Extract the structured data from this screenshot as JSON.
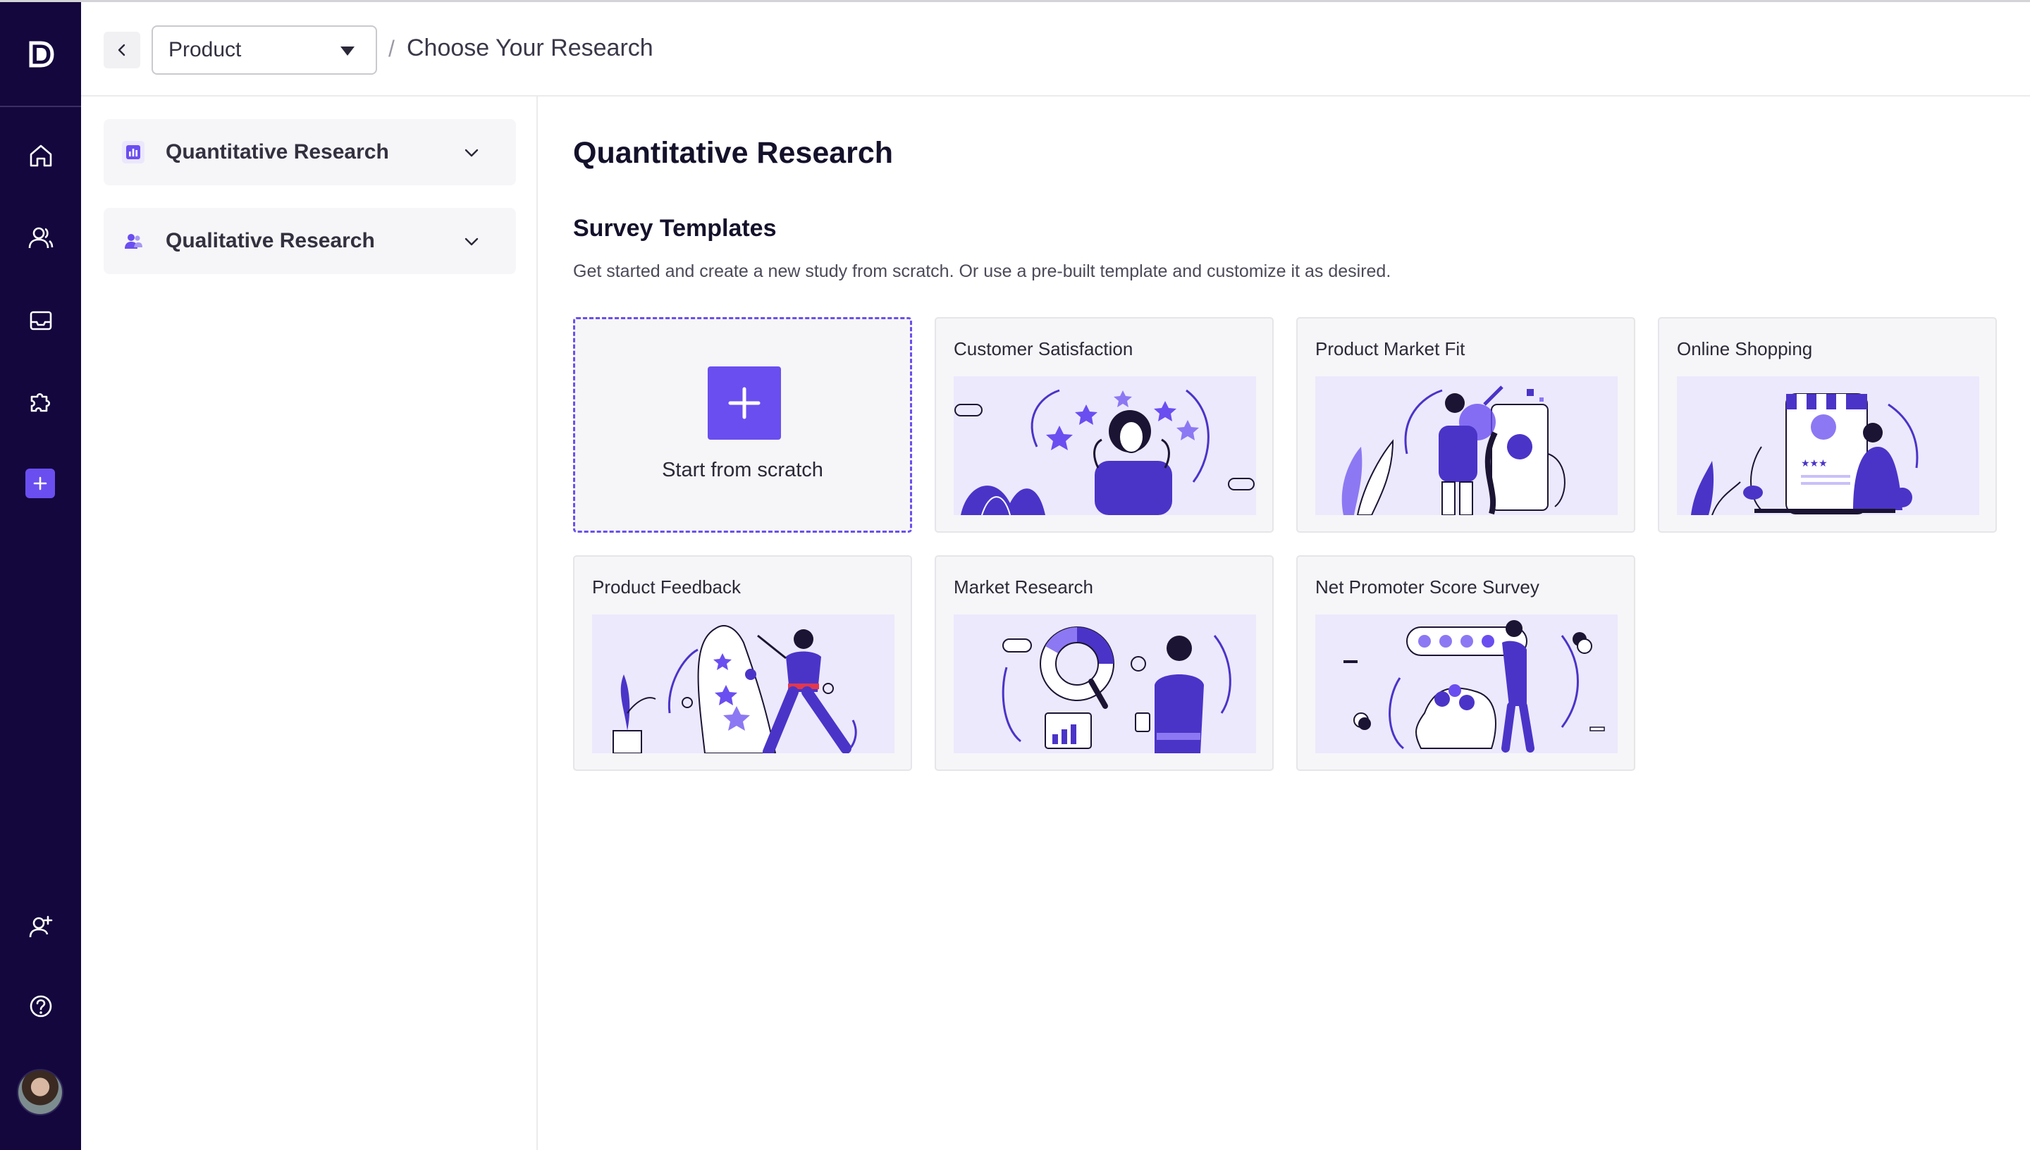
{
  "app": {
    "logo_letter": "D"
  },
  "rail": {
    "items": [
      {
        "name": "home",
        "icon": "home-icon"
      },
      {
        "name": "people",
        "icon": "users-icon"
      },
      {
        "name": "inbox",
        "icon": "inbox-icon"
      },
      {
        "name": "integrations",
        "icon": "puzzle-icon"
      },
      {
        "name": "create",
        "icon": "plus-icon"
      }
    ],
    "bottom": [
      {
        "name": "invite",
        "icon": "user-plus-icon"
      },
      {
        "name": "help",
        "icon": "help-icon"
      }
    ],
    "accent": "#6b4ef0",
    "background": "#14073d"
  },
  "topbar": {
    "workspace_select": {
      "value": "Product"
    },
    "separator": "/",
    "title": "Choose Your Research"
  },
  "sidenav": {
    "items": [
      {
        "label": "Quantitative Research",
        "icon": "bar-chart-icon"
      },
      {
        "label": "Qualitative Research",
        "icon": "users-icon"
      }
    ]
  },
  "main": {
    "title": "Quantitative Research",
    "section_title": "Survey Templates",
    "section_desc": "Get started and create a new study from scratch. Or use a pre-built template and customize it as desired.",
    "scratch_label": "Start from scratch",
    "templates": [
      {
        "title": "Customer Satisfaction"
      },
      {
        "title": "Product Market Fit"
      },
      {
        "title": "Online Shopping"
      },
      {
        "title": "Product Feedback"
      },
      {
        "title": "Market Research"
      },
      {
        "title": "Net Promoter Score Survey"
      }
    ]
  }
}
